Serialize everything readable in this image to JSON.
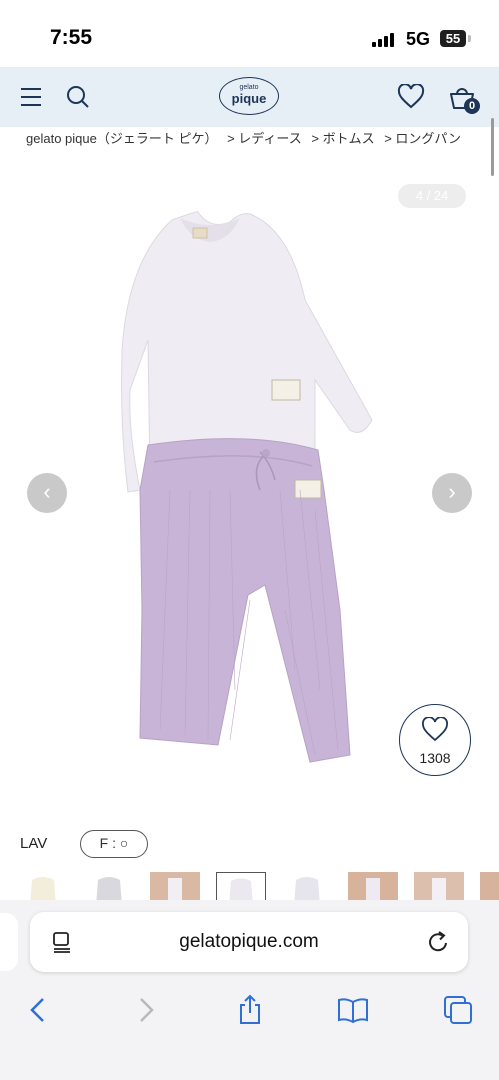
{
  "status_bar": {
    "time": "7:55",
    "network": "5G",
    "battery": "55"
  },
  "header": {
    "logo_small": "gelato",
    "logo_main": "pique",
    "cart_count": "0"
  },
  "breadcrumb": [
    "gelato pique（ジェラート ピケ）",
    "> レディース",
    "> ボトムス",
    "> ロングパン"
  ],
  "gallery": {
    "counter": "4 / 24",
    "prev_arrow": "‹",
    "next_arrow": "›",
    "favorite_count": "1308"
  },
  "product": {
    "color_code": "LAV",
    "size_label": "F : ○"
  },
  "browser": {
    "url": "gelatopique.com"
  },
  "colors": {
    "header_bg": "#e6eef6",
    "brand_navy": "#1d3557",
    "sweater": "#efedf3",
    "pants": "#c7b4d6"
  },
  "icons": [
    "status-signal-icon",
    "menu-icon",
    "search-icon",
    "heart-icon",
    "cart-icon",
    "reader-icon",
    "reload-icon",
    "back-icon",
    "forward-icon",
    "share-icon",
    "bookmarks-icon",
    "tabs-icon"
  ]
}
